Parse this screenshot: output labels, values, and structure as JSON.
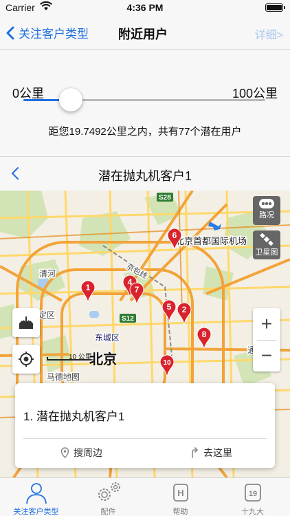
{
  "status_bar": {
    "carrier": "Carrier",
    "time": "4:36 PM"
  },
  "nav": {
    "back_label": "关注客户类型",
    "title": "附近用户",
    "detail_label": "详细>"
  },
  "slider": {
    "min_label": "0公里",
    "max_label": "100公里",
    "value_fraction": 0.197,
    "summary": "距您19.7492公里之内，共有77个潜在用户"
  },
  "map_header": {
    "title": "潜在抛丸机客户1"
  },
  "map": {
    "airport_label": "北京首都国际机场",
    "city_label": "北京",
    "scale_label": "10 公里",
    "traffic_label": "路况",
    "satellite_label": "卫星图",
    "place_labels": [
      "清河",
      "定区",
      "东城区",
      "马德地图",
      "通州区",
      "京包线",
      "S28",
      "S12",
      "S12"
    ],
    "markers": [
      "1",
      "2",
      "4",
      "5",
      "6",
      "7",
      "8",
      "10"
    ],
    "zoom_in": "+",
    "zoom_out": "−"
  },
  "card": {
    "name": "1. 潜在抛丸机客户1",
    "action_nearby": "搜周边",
    "action_go": "去这里"
  },
  "tabs": [
    {
      "label": "关注客户类型",
      "icon": "person-icon"
    },
    {
      "label": "配件",
      "icon": "gears-icon"
    },
    {
      "label": "帮助",
      "icon": "help-h-icon",
      "glyph": "H"
    },
    {
      "label": "十九大",
      "icon": "calendar-19-icon",
      "glyph": "19"
    }
  ],
  "colors": {
    "accent": "#1e6fe0",
    "marker": "#d9232d",
    "road_major": "#f2a33a",
    "road_minor": "#ffd86b"
  }
}
